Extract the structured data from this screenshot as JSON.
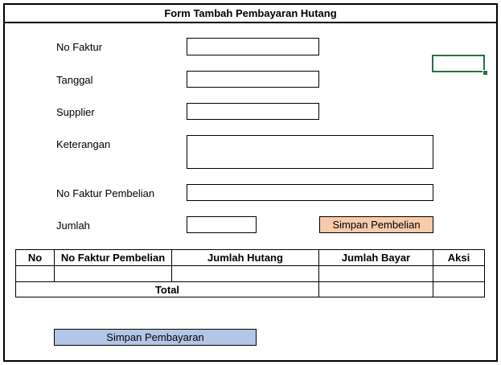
{
  "form": {
    "title": "Form Tambah Pembayaran Hutang",
    "fields": {
      "no_faktur": {
        "label": "No Faktur",
        "value": ""
      },
      "tanggal": {
        "label": "Tanggal",
        "value": ""
      },
      "supplier": {
        "label": "Supplier",
        "value": ""
      },
      "keterangan": {
        "label": "Keterangan",
        "value": ""
      },
      "no_faktur_pembelian": {
        "label": "No Faktur Pembelian",
        "value": ""
      },
      "jumlah": {
        "label": "Jumlah",
        "value": ""
      }
    },
    "buttons": {
      "simpan_pembelian": "Simpan Pembelian",
      "simpan_pembayaran": "Simpan Pembayaran"
    }
  },
  "table": {
    "headers": [
      "No",
      "No Faktur Pembelian",
      "Jumlah Hutang",
      "Jumlah Bayar",
      "Aksi"
    ],
    "rows": [
      [
        "",
        "",
        "",
        "",
        ""
      ]
    ],
    "total_label": "Total",
    "total_hutang": "",
    "total_bayar": "",
    "total_aksi": ""
  },
  "colors": {
    "simpan_pembelian_bg": "#f8cbad",
    "simpan_pembayaran_bg": "#b4c6e7",
    "selection_border": "#217346"
  }
}
